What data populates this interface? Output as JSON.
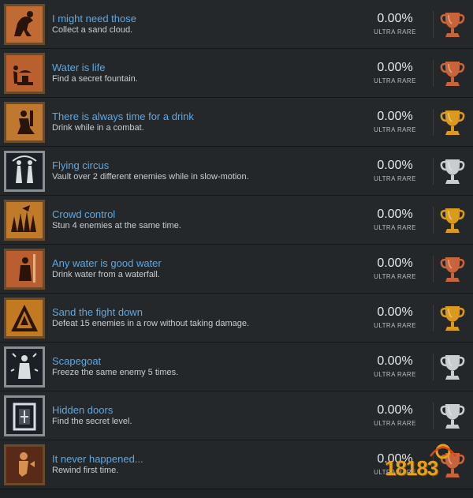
{
  "achievements": [
    {
      "title": "I might need those",
      "description": "Collect a sand cloud.",
      "percent": "0.00%",
      "rarity": "ULTRA RARE",
      "trophy": "bronze",
      "icon_frame": "bronze",
      "icon": "figure-bending-icon"
    },
    {
      "title": "Water is life",
      "description": "Find a secret fountain.",
      "percent": "0.00%",
      "rarity": "ULTRA RARE",
      "trophy": "bronze",
      "icon_frame": "bronze",
      "icon": "fountain-icon"
    },
    {
      "title": "There is always time for a drink",
      "description": "Drink while in a combat.",
      "percent": "0.00%",
      "rarity": "ULTRA RARE",
      "trophy": "gold",
      "icon_frame": "bronze",
      "icon": "kneeling-figure-icon"
    },
    {
      "title": "Flying circus",
      "description": "Vault over 2 different enemies while in slow-motion.",
      "percent": "0.00%",
      "rarity": "ULTRA RARE",
      "trophy": "silver",
      "icon_frame": "silver",
      "icon": "acrobats-icon"
    },
    {
      "title": "Crowd control",
      "description": "Stun 4 enemies at the same time.",
      "percent": "0.00%",
      "rarity": "ULTRA RARE",
      "trophy": "gold",
      "icon_frame": "bronze",
      "icon": "crowd-icon"
    },
    {
      "title": "Any water is good water",
      "description": "Drink water from a waterfall.",
      "percent": "0.00%",
      "rarity": "ULTRA RARE",
      "trophy": "bronze",
      "icon_frame": "bronze",
      "icon": "waterfall-figure-icon"
    },
    {
      "title": "Sand the fight down",
      "description": "Defeat 15 enemies in a row without taking damage.",
      "percent": "0.00%",
      "rarity": "ULTRA RARE",
      "trophy": "gold",
      "icon_frame": "bronze",
      "icon": "pyramid-icon"
    },
    {
      "title": "Scapegoat",
      "description": "Freeze the same enemy 5 times.",
      "percent": "0.00%",
      "rarity": "ULTRA RARE",
      "trophy": "silver",
      "icon_frame": "silver",
      "icon": "frozen-figure-icon"
    },
    {
      "title": "Hidden doors",
      "description": "Find the secret level.",
      "percent": "0.00%",
      "rarity": "ULTRA RARE",
      "trophy": "silver",
      "icon_frame": "silver",
      "icon": "door-icon"
    },
    {
      "title": "It never happened...",
      "description": "Rewind first time.",
      "percent": "0.00%",
      "rarity": "ULTRA RARE",
      "trophy": "bronze",
      "icon_frame": "bronze",
      "icon": "rewind-figure-icon"
    }
  ],
  "colors": {
    "bronze": "#c8643a",
    "gold": "#d99a1e",
    "silver": "#c9ccd1",
    "title": "#5aa9e6",
    "background": "#202326"
  },
  "watermark": {
    "text": "18183"
  }
}
